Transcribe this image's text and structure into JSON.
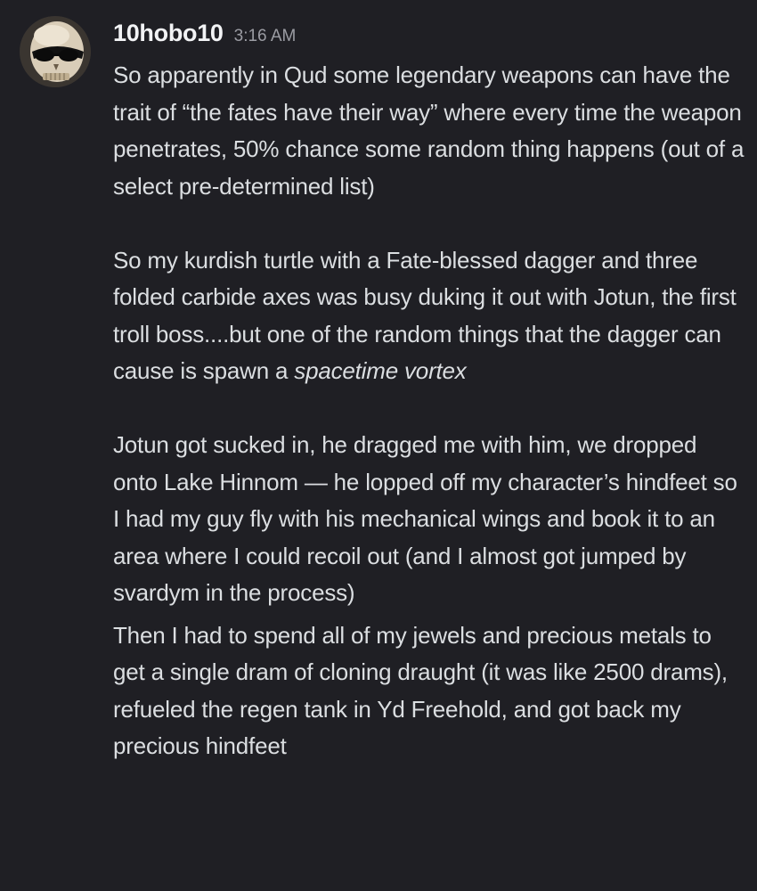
{
  "message": {
    "username": "10hobo10",
    "timestamp": "3:16 AM",
    "avatar_icon": "skull-with-sunglasses-icon",
    "paragraphs": {
      "p1": "So apparently in Qud some legendary weapons can have the trait of “the fates have their way” where every time the weapon penetrates, 50% chance some random thing happens (out of a select pre-determined list)",
      "p2_main": "So my kurdish turtle with a Fate-blessed dagger and three folded carbide axes was busy duking it out with Jotun, the first troll boss....but one of the random things that the dagger can cause is spawn a ",
      "p2_italic": "spacetime vortex",
      "p3": "Jotun got sucked in, he dragged me with him, we dropped onto Lake Hinnom — he lopped off my character’s hindfeet so I had my guy fly with his mechanical wings and book it to an area where I could recoil out (and I almost got jumped by svardym in the process)",
      "p4": "Then I had to spend all of my jewels and precious metals to get a single dram of cloning draught (it was like 2500 drams), refueled the regen tank in Yd Freehold, and got back my precious hindfeet"
    }
  },
  "colors": {
    "background": "#1f1f24",
    "username": "#f2f3f5",
    "timestamp": "#9b9ca3",
    "text": "#dbdee1"
  }
}
